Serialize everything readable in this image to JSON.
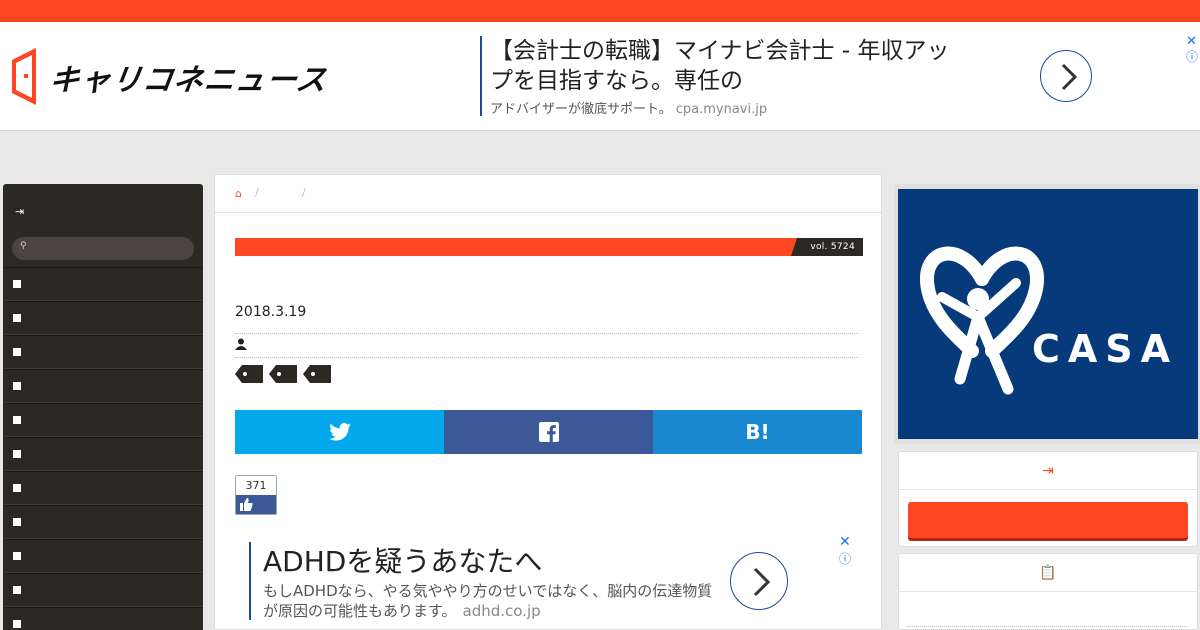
{
  "header": {
    "logo_text": "キャリコネニュース"
  },
  "top_ad": {
    "title": "【会計士の転職】マイナビ会計士 - 年収アップを目指すなら。専任の",
    "subtitle": "アドバイザーが徹底サポート。",
    "url": "cpa.mynavi.jp",
    "close_glyph": "✕",
    "info_glyph": "ⓘ"
  },
  "leftnav": {
    "login_glyph": "⇥",
    "search_glyph": "⚲",
    "item_count": 11
  },
  "breadcrumb": {
    "home_glyph": "⌂",
    "sep": "/"
  },
  "article": {
    "volume": "vol. 5724",
    "date": "2018.3.19",
    "user_glyph": "👤",
    "like_count": "371"
  },
  "share": {
    "twitter_glyph": "🐦",
    "facebook_glyph": "f",
    "hatena_label": "B!"
  },
  "bottom_ad": {
    "title": "ADHDを疑うあなたへ",
    "subtitle": "もしADHDなら、やる気ややり方のせいではなく、脳内の伝達物質が原因の可能性もあります。",
    "url": "adhd.co.jp",
    "close_glyph": "✕",
    "info_glyph": "ⓘ"
  },
  "sidebar": {
    "banner_text": "CASA",
    "banner_reg": "®",
    "panel1_glyph": "⇥",
    "panel2_glyph": "📋"
  },
  "colors": {
    "accent": "#ff4622",
    "nav_bg": "#2c2824",
    "twitter": "#03a9ec",
    "facebook": "#3b5998",
    "hatena": "#1a88d0",
    "casa_blue": "#063a7a"
  }
}
